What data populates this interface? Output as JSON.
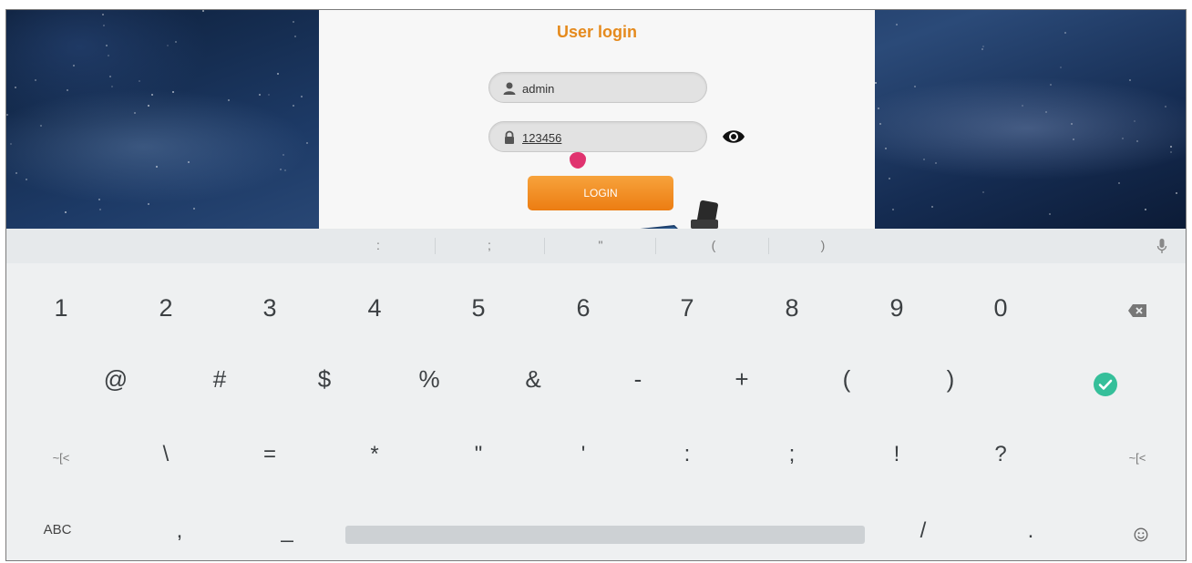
{
  "login": {
    "title": "User login",
    "username": "admin",
    "password": "123456",
    "button_label": "LOGIN",
    "icons": {
      "user": "user-icon",
      "lock": "lock-icon",
      "eye": "eye-icon"
    }
  },
  "keyboard": {
    "suggestions": [
      ":",
      ";",
      "\"",
      "(",
      ")"
    ],
    "row1": [
      "1",
      "2",
      "3",
      "4",
      "5",
      "6",
      "7",
      "8",
      "9",
      "0"
    ],
    "row2": [
      "@",
      "#",
      "$",
      "%",
      "&",
      "-",
      "+",
      "(",
      ")"
    ],
    "row3": [
      "~[<",
      "\\",
      "=",
      "*",
      "\"",
      "'",
      ":",
      ";",
      "!",
      "?",
      "~[<"
    ],
    "row4_abc": "ABC",
    "row4_comma": ",",
    "row4_underscore": "_",
    "row4_slash": "/",
    "row4_period": ".",
    "icons": {
      "mic": "mic-icon",
      "backspace": "backspace-icon",
      "done": "checkmark-done-icon",
      "emoji": "emoji-icon"
    },
    "colors": {
      "done": "#35bf9a",
      "login_button": "#ec7d12",
      "title": "#e58a1d"
    }
  }
}
